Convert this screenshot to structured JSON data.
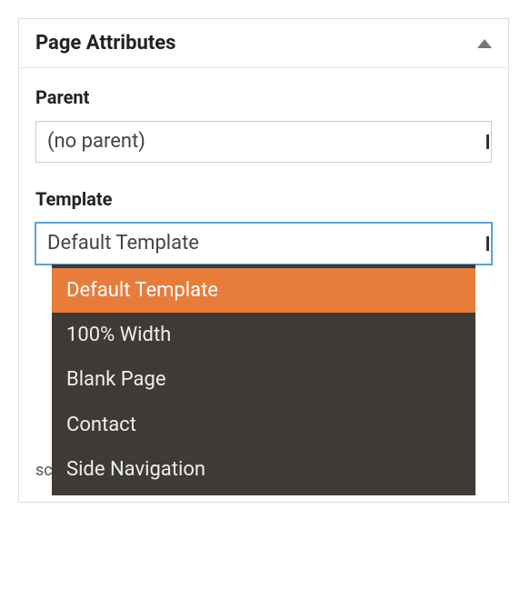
{
  "panel": {
    "title": "Page Attributes"
  },
  "parent": {
    "label": "Parent",
    "value": "(no parent)"
  },
  "template": {
    "label": "Template",
    "value": "Default Template",
    "options": [
      "Default Template",
      "100% Width",
      "Blank Page",
      "Contact",
      "Side Navigation"
    ],
    "highlighted_index": 0
  },
  "help_fragment": "screen title."
}
